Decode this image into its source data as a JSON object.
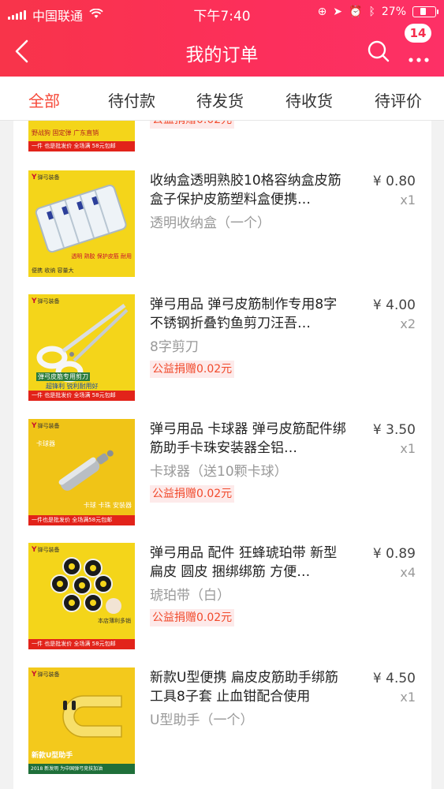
{
  "status_bar": {
    "carrier": "中国联通",
    "time": "下午7:40",
    "battery": "27%",
    "battery_level": 0.27
  },
  "nav": {
    "title": "我的订单",
    "message_count": "14"
  },
  "tabs": [
    "全部",
    "待付款",
    "待发货",
    "待收货",
    "待评价"
  ],
  "active_tab": "全部",
  "partial_item": {
    "thumb_caption": "野战狗 固定弹 广东直销",
    "thumb_bottom": "一件 也是批发价  全场满 58元包邮",
    "charity": "公益捐赠0.02元"
  },
  "items": [
    {
      "title": "收纳盒透明熟胶10格容纳盒皮筋盒子保护皮筋塑料盒便携…",
      "spec": "透明收纳盒（一个）",
      "price": "¥ 0.80",
      "qty": "x1",
      "thumb_texts": [
        "便携 收纳 容量大",
        "透明 熟胶 保护皮筋 耐用"
      ]
    },
    {
      "title": "弹弓用品 弹弓皮筋制作专用8字不锈钢折叠钓鱼剪刀汪吾…",
      "spec": "8字剪刀",
      "charity": "公益捐赠0.02元",
      "price": "¥ 4.00",
      "qty": "x2",
      "thumb_texts": [
        "弹弓皮筋专用剪刀",
        "超锋利 锐利耐用好"
      ],
      "thumb_bottom": "一件 也是批发价  全场满 58元包邮"
    },
    {
      "title": "弹弓用品 卡球器 弹弓皮筋配件绑筋助手卡珠安装器全铝…",
      "spec": "卡球器（送10颗卡球）",
      "charity": "公益捐赠0.02元",
      "price": "¥ 3.50",
      "qty": "x1",
      "thumb_texts": [
        "卡球器",
        "卡球 卡珠 安装器"
      ],
      "thumb_bottom": "一件也是批发价  全场满58元包邮"
    },
    {
      "title": "弹弓用品 配件 狂蜂琥珀带 新型 扁皮 圆皮 捆绑绑筋 方便…",
      "spec": "琥珀带（白）",
      "charity": "公益捐赠0.02元",
      "price": "¥ 0.89",
      "qty": "x4",
      "thumb_texts": [
        "本店薄利多销"
      ],
      "thumb_bottom": "一件 也是批发价  全场满 58元包邮"
    },
    {
      "title": "新款U型便携 扁皮皮筋助手绑筋工具8子套 止血钳配合使用",
      "spec": "U型助手（一个）",
      "price": "¥ 4.50",
      "qty": "x1",
      "thumb_texts": [
        "新款U型助手",
        "2018 新发明 为中国弹弓竞技加油"
      ]
    }
  ],
  "colors": {
    "header_start": "#f8344a",
    "header_end": "#fd3066",
    "active_tab": "#f64a3a",
    "charity_text": "#f14a2c",
    "thumb_bg": "#f4d51a"
  }
}
